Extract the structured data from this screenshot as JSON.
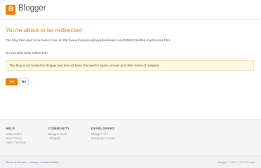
{
  "header": {
    "logo_letter": "B",
    "brand": "Blogger"
  },
  "main": {
    "title": "You're about to be redirected",
    "notice": "The blog that used to be here is now at http://www.traceysculinaryadventures.com/2008/01/stuffed-mushrooms.html",
    "question": "Do you wish to be redirected?",
    "warning": "This blog is not hosted by Blogger and has not been checked for spam, viruses and other forms of malware.",
    "yes_label": "Yes",
    "no_label": "No"
  },
  "footer": {
    "help": {
      "heading": "HELP",
      "links": [
        "Help Center",
        "Help Forum",
        "Video Tutorials"
      ]
    },
    "community": {
      "heading": "COMMUNITY",
      "links": [
        "Blogger Buzz",
        "+Blogger"
      ]
    },
    "developers": {
      "heading": "DEVELOPERS",
      "links": [
        "Blogger API",
        "Developer Forum"
      ]
    }
  },
  "bottom": {
    "links": [
      "Terms of Service",
      "Privacy",
      "Content Policy"
    ],
    "separator": "-",
    "copyright": "Blogger - 1999 – 2014 Google"
  },
  "colors": {
    "accent": "#f57d00",
    "warning_bg": "#fff9e0"
  }
}
